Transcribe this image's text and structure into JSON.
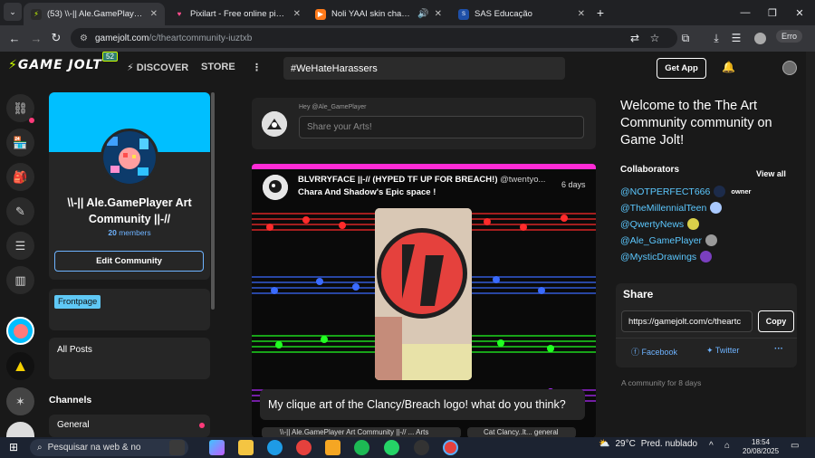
{
  "browser": {
    "tabs": [
      {
        "title": "(53) \\\\-|| Ale.GamePlayer Art Co",
        "active": true
      },
      {
        "title": "Pixilart - Free online pixel art dr",
        "active": false
      },
      {
        "title": "Noli YAAI skin chase theme",
        "active": false
      },
      {
        "title": "SAS Educação",
        "active": false
      }
    ],
    "url_host": "gamejolt.com",
    "url_path": "/c/theartcommunity-iuztxb",
    "profile_label": "Erro"
  },
  "gj": {
    "logo_a": "GAME",
    "logo_b": "JOLT",
    "badge": "52",
    "discover": "DISCOVER",
    "store": "STORE",
    "search_value": "#WeHateHarassers",
    "get_app": "Get App"
  },
  "community": {
    "name": "\\\\-|| Ale.GamePlayer Art Community ||-//",
    "members_count": "20",
    "members_label": "members",
    "edit_button": "Edit Community",
    "frontpage": "Frontpage",
    "all_posts": "All Posts",
    "channels_heading": "Channels",
    "channel_general": "General"
  },
  "composer": {
    "hey": "Hey @Ale_GamePlayer",
    "placeholder": "Share your Arts!"
  },
  "post": {
    "title": "BLVRRYFACE ||-// (HYPED TF UP FOR BREACH!)",
    "username": "@twentyo...",
    "subtitle": "Chara And Shadow's Epic space !",
    "time": "6 days",
    "caption": "My clique art of the Clancy/Breach logo! what do you think?",
    "chip1": "\\\\-|| Ale.GamePlayer Art Community ||-// ... Arts",
    "chip2": "Cat Clancy..lt... general"
  },
  "sidebar_right": {
    "welcome": "Welcome to the The Art Community community on Game Jolt!",
    "collaborators_heading": "Collaborators",
    "view_all": "View all",
    "collaborators": [
      {
        "name": "@NOTPERFECT666",
        "role": "owner"
      },
      {
        "name": "@TheMillennialTeen",
        "role": ""
      },
      {
        "name": "@QwertyNews",
        "role": ""
      },
      {
        "name": "@Ale_GamePlayer",
        "role": ""
      },
      {
        "name": "@MysticDrawings",
        "role": ""
      }
    ],
    "share_heading": "Share",
    "share_url": "https://gamejolt.com/c/theartc",
    "copy": "Copy",
    "facebook": "Facebook",
    "twitter": "Twitter",
    "age": "A community for 8 days"
  },
  "taskbar": {
    "search_placeholder": "Pesquisar na web & no",
    "temperature": "29°C",
    "weather_text": "Pred. nublado",
    "time": "18:54",
    "date": "20/08/2025"
  },
  "colors": {
    "accent_lime": "#ccff00",
    "link_blue": "#5cc8ff",
    "banner_cyan": "#00bfff",
    "notif_pink": "#ff3a7a"
  }
}
